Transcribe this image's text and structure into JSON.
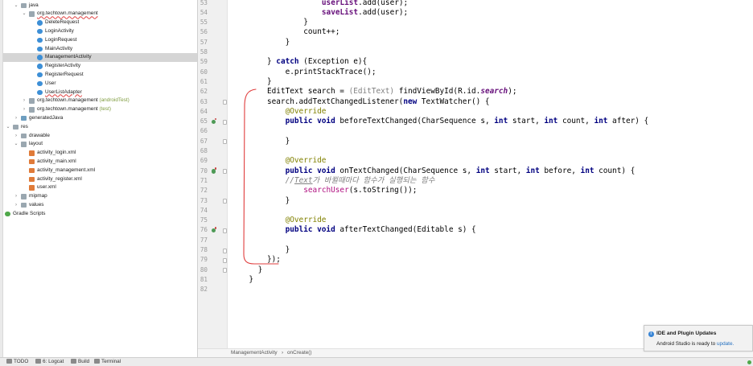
{
  "project_tree": [
    {
      "label": "java",
      "indent": 0,
      "icon": "folder-icon",
      "arrow": "open"
    },
    {
      "label": "org.techtown.management",
      "indent": 1,
      "icon": "folder-icon",
      "arrow": "open",
      "underline": true
    },
    {
      "label": "DeleteRequest",
      "indent": 2,
      "icon": "class-icon"
    },
    {
      "label": "LoginActivity",
      "indent": 2,
      "icon": "class-icon"
    },
    {
      "label": "LoginRequest",
      "indent": 2,
      "icon": "class-icon"
    },
    {
      "label": "MainActivity",
      "indent": 2,
      "icon": "class-icon"
    },
    {
      "label": "ManagementActivity",
      "indent": 2,
      "icon": "class-icon",
      "selected": true
    },
    {
      "label": "RegisterActivity",
      "indent": 2,
      "icon": "class-icon"
    },
    {
      "label": "RegisterRequest",
      "indent": 2,
      "icon": "class-icon"
    },
    {
      "label": "User",
      "indent": 2,
      "icon": "class-icon"
    },
    {
      "label": "UserListAdapter",
      "indent": 2,
      "icon": "class-icon",
      "underline": true
    },
    {
      "label": "org.techtown.management",
      "suffix": "(androidTest)",
      "indent": 1,
      "icon": "folder-icon",
      "arrow": "closed"
    },
    {
      "label": "org.techtown.management",
      "suffix": "(test)",
      "indent": 1,
      "icon": "folder-icon",
      "arrow": "closed"
    },
    {
      "label": "generatedJava",
      "indent": 0,
      "icon": "folder-icon-gen",
      "arrow": "closed"
    },
    {
      "label": "res",
      "indent": -1,
      "icon": "folder-icon",
      "arrow": "open"
    },
    {
      "label": "drawable",
      "indent": 0,
      "icon": "folder-icon",
      "arrow": "closed"
    },
    {
      "label": "layout",
      "indent": 0,
      "icon": "folder-icon",
      "arrow": "open"
    },
    {
      "label": "activity_login.xml",
      "indent": 1,
      "icon": "xml-icon"
    },
    {
      "label": "activity_main.xml",
      "indent": 1,
      "icon": "xml-icon"
    },
    {
      "label": "activity_management.xml",
      "indent": 1,
      "icon": "xml-icon"
    },
    {
      "label": "activity_register.xml",
      "indent": 1,
      "icon": "xml-icon"
    },
    {
      "label": "user.xml",
      "indent": 1,
      "icon": "xml-icon"
    },
    {
      "label": "mipmap",
      "indent": 0,
      "icon": "folder-icon",
      "arrow": "closed"
    },
    {
      "label": "values",
      "indent": 0,
      "icon": "folder-icon",
      "arrow": "closed"
    },
    {
      "label": "Gradle Scripts",
      "indent": -2,
      "icon": "gradle-icon",
      "arrow": "closed"
    }
  ],
  "editor": {
    "lines": [
      {
        "n": "53",
        "indent": 12,
        "html": "<span class=\"fieldb\">userList</span>.add(user);"
      },
      {
        "n": "54",
        "indent": 12,
        "html": "<span class=\"fieldb\">saveList</span>.add(user);"
      },
      {
        "n": "55",
        "indent": 8,
        "html": "}"
      },
      {
        "n": "56",
        "indent": 8,
        "html": "count++;"
      },
      {
        "n": "57",
        "indent": 4,
        "html": "}"
      },
      {
        "n": "58",
        "indent": 0,
        "html": ""
      },
      {
        "n": "59",
        "indent": 0,
        "html": "} <span class=\"kw\">catch</span> (Exception e){"
      },
      {
        "n": "60",
        "indent": 4,
        "html": "e.printStackTrace();"
      },
      {
        "n": "61",
        "indent": 0,
        "html": "}"
      },
      {
        "n": "62",
        "indent": 0,
        "html": "EditText search = <span class=\"cast\">(EditText)</span> findViewById(R.id.<span class=\"it\">search</span>);"
      },
      {
        "n": "63",
        "indent": 0,
        "html": "search.addTextChangedListener(<span class=\"kw\">new</span> TextWatcher() {",
        "fold": true
      },
      {
        "n": "64",
        "indent": 4,
        "html": "<span class=\"ann\">@Override</span>"
      },
      {
        "n": "65",
        "indent": 4,
        "html": "<span class=\"kw\">public void</span> beforeTextChanged(CharSequence s, <span class=\"kw\">int</span> start, <span class=\"kw\">int</span> count, <span class=\"kw\">int</span> after) {",
        "marker": true,
        "fold": true
      },
      {
        "n": "66",
        "indent": 0,
        "html": ""
      },
      {
        "n": "67",
        "indent": 4,
        "html": "}",
        "fold": true
      },
      {
        "n": "68",
        "indent": 0,
        "html": ""
      },
      {
        "n": "69",
        "indent": 4,
        "html": "<span class=\"ann\">@Override</span>"
      },
      {
        "n": "70",
        "indent": 4,
        "html": "<span class=\"kw\">public void</span> onTextChanged(CharSequence s, <span class=\"kw\">int</span> start, <span class=\"kw\">int</span> before, <span class=\"kw\">int</span> count) {",
        "marker": true,
        "fold": true
      },
      {
        "n": "71",
        "indent": 4,
        "html": "<span class=\"cm\">//<u>Text</u>가 바뀔때마다 함수가 실행되는 함수</span>"
      },
      {
        "n": "72",
        "indent": 8,
        "html": "<span class=\"call\">searchUser</span>(s.toString());"
      },
      {
        "n": "73",
        "indent": 4,
        "html": "}",
        "fold": true
      },
      {
        "n": "74",
        "indent": 0,
        "html": ""
      },
      {
        "n": "75",
        "indent": 4,
        "html": "<span class=\"ann\">@Override</span>"
      },
      {
        "n": "76",
        "indent": 4,
        "html": "<span class=\"kw\">public void</span> afterTextChanged(Editable s) {",
        "marker": true,
        "fold": true
      },
      {
        "n": "77",
        "indent": 0,
        "html": ""
      },
      {
        "n": "78",
        "indent": 4,
        "html": "}",
        "fold": true
      },
      {
        "n": "79",
        "indent": 0,
        "html": "});",
        "fold": true
      },
      {
        "n": "80",
        "indent": -2,
        "html": "}",
        "fold": true
      },
      {
        "n": "81",
        "indent": -4,
        "html": "}"
      },
      {
        "n": "82",
        "indent": 0,
        "html": ""
      }
    ]
  },
  "breadcrumb": {
    "class_name": "ManagementActivity",
    "separator": "›",
    "method": "onCreate()"
  },
  "bottom_bar": {
    "todo": "TODO",
    "logcat": "6: Logcat",
    "build": "Build",
    "terminal": "Terminal"
  },
  "notification": {
    "icon": "i",
    "title": "IDE and Plugin Updates",
    "body": "Android Studio is ready to ",
    "link": "update."
  }
}
